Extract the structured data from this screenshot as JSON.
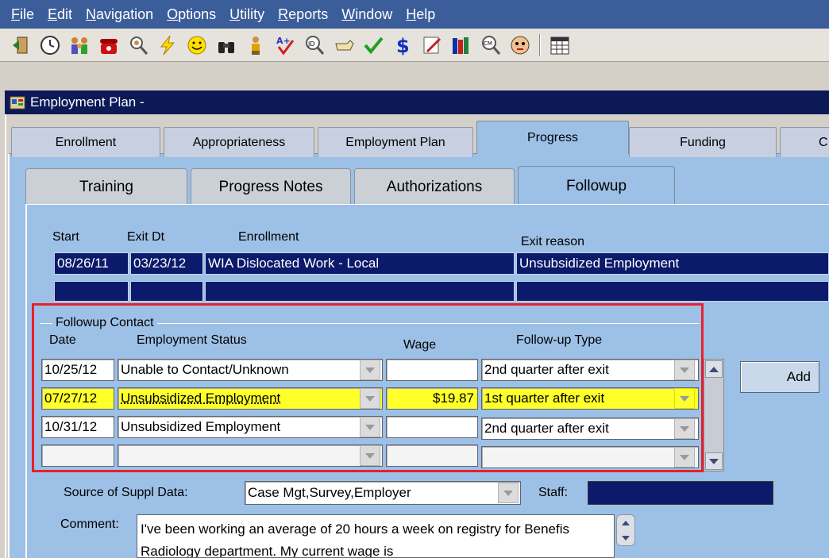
{
  "menubar": {
    "items": [
      "File",
      "Edit",
      "Navigation",
      "Options",
      "Utility",
      "Reports",
      "Window",
      "Help"
    ],
    "accelerators": [
      "F",
      "E",
      "N",
      "O",
      "U",
      "R",
      "W",
      "H"
    ]
  },
  "toolbar": {
    "icons": [
      "exit-icon",
      "clock-icon",
      "family-icon",
      "telephone-icon",
      "person-search-icon",
      "lightning-icon",
      "smiley-icon",
      "binoculars-icon",
      "person-icon",
      "grade-check-icon",
      "search-jd-icon",
      "pointing-hand-icon",
      "checkmark-icon",
      "dollar-icon",
      "edit-icon",
      "books-icon",
      "search-cm-icon",
      "face-icon",
      "calendar-icon"
    ]
  },
  "window": {
    "title": "Employment Plan -"
  },
  "top_tabs": [
    {
      "label": "Enrollment"
    },
    {
      "label": "Appropriateness"
    },
    {
      "label": "Employment Plan"
    },
    {
      "label": "Progress"
    },
    {
      "label": "Funding"
    },
    {
      "label": "C"
    }
  ],
  "sub_tabs": [
    {
      "label": "Training"
    },
    {
      "label": "Progress Notes"
    },
    {
      "label": "Authorizations"
    },
    {
      "label": "Followup"
    }
  ],
  "enrollment_table": {
    "headers": {
      "start": "Start",
      "exit": "Exit Dt",
      "enrollment": "Enrollment",
      "exit_reason": "Exit reason"
    },
    "row": {
      "start": "08/26/11",
      "exit": "03/23/12",
      "enrollment": "WIA Dislocated Work - Local",
      "exit_reason": "Unsubsidized Employment"
    }
  },
  "followup": {
    "group_label": "Followup Contact",
    "headers": {
      "date": "Date",
      "status": "Employment Status",
      "wage": "Wage",
      "type": "Follow-up Type"
    },
    "rows": [
      {
        "date": "10/25/12",
        "status": "Unable to Contact/Unknown",
        "wage": "",
        "type": "2nd quarter after exit"
      },
      {
        "date": "07/27/12",
        "status": "Unsubsidized Employment",
        "wage": "$19.87",
        "type": "1st quarter after exit"
      },
      {
        "date": "10/31/12",
        "status": "Unsubsidized Employment",
        "wage": "",
        "type": "2nd quarter after exit"
      },
      {
        "date": "",
        "status": "",
        "wage": "",
        "type": ""
      }
    ],
    "add_label": "Add"
  },
  "source": {
    "label": "Source of Suppl Data:",
    "value": "Case Mgt,Survey,Employer",
    "staff_label": "Staff:"
  },
  "comment": {
    "label": "Comment:",
    "text": "I've been working an average of 20 hours a week on registry for Benefis Radiology department.   My current wage is"
  }
}
